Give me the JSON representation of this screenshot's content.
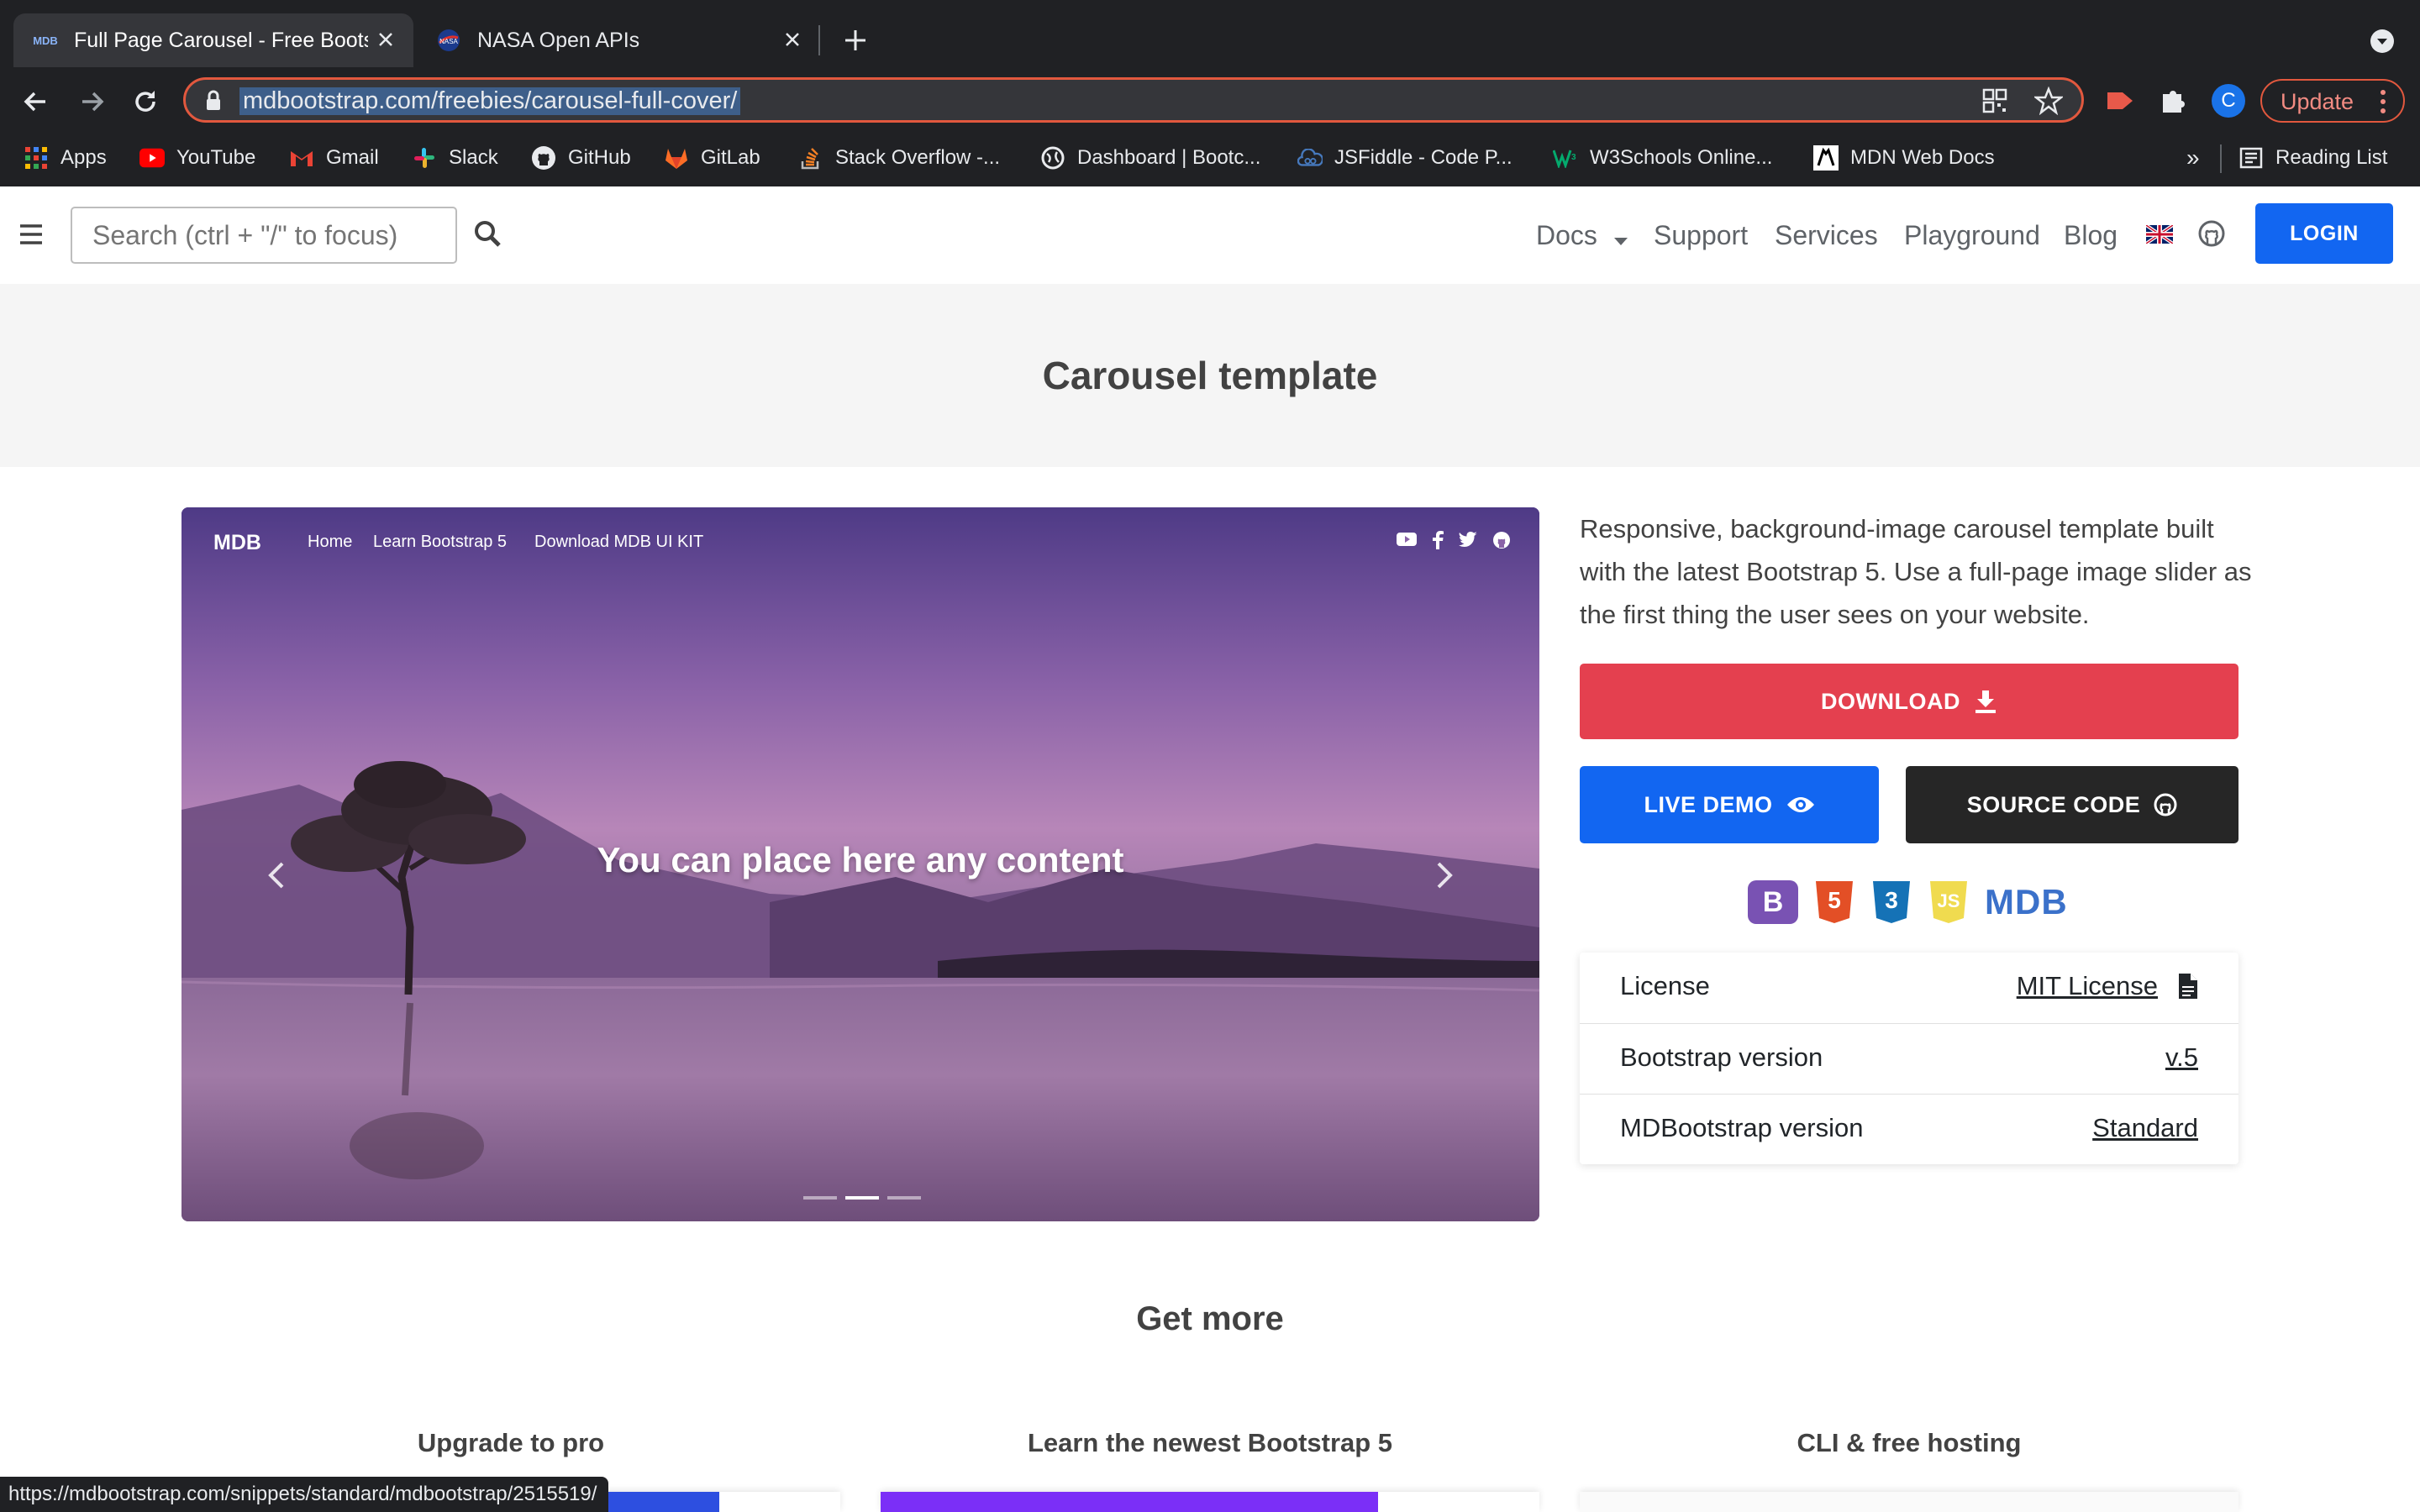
{
  "browser": {
    "tabs": [
      {
        "title": "Full Page Carousel - Free Bootst",
        "active": true
      },
      {
        "title": "NASA Open APIs",
        "active": false
      }
    ],
    "url": "mdbootstrap.com/freebies/carousel-full-cover/",
    "profile_initial": "C",
    "update_label": "Update",
    "bookmarks": [
      {
        "label": "Apps",
        "icon": "apps-grid-icon"
      },
      {
        "label": "YouTube",
        "icon": "youtube-icon"
      },
      {
        "label": "Gmail",
        "icon": "gmail-icon"
      },
      {
        "label": "Slack",
        "icon": "slack-icon"
      },
      {
        "label": "GitHub",
        "icon": "github-icon"
      },
      {
        "label": "GitLab",
        "icon": "gitlab-icon"
      },
      {
        "label": "Stack Overflow -...",
        "icon": "stackoverflow-icon"
      },
      {
        "label": "Dashboard | Bootc...",
        "icon": "globe-icon"
      },
      {
        "label": "JSFiddle - Code P...",
        "icon": "jsfiddle-icon"
      },
      {
        "label": "W3Schools Online...",
        "icon": "w3schools-icon"
      },
      {
        "label": "MDN Web Docs",
        "icon": "mdn-icon"
      }
    ],
    "overflow_label": "»",
    "reading_list_label": "Reading List",
    "status_url": "https://mdbootstrap.com/snippets/standard/mdbootstrap/2515519/"
  },
  "site_nav": {
    "search_placeholder": "Search (ctrl + \"/\" to focus)",
    "links": [
      "Docs",
      "Support",
      "Services",
      "Playground",
      "Blog"
    ],
    "login_label": "LOGIN"
  },
  "hero": {
    "title": "Carousel template"
  },
  "preview": {
    "brand": "MDB",
    "nav": [
      "Home",
      "Learn Bootstrap 5",
      "Download MDB UI KIT"
    ],
    "caption": "You can place here any content",
    "active_slide": 2,
    "slide_count": 3
  },
  "side": {
    "description": "Responsive, background-image carousel template built with the latest Bootstrap 5. Use a full-page image slider as the first thing the user sees on your website.",
    "download_label": "DOWNLOAD",
    "live_demo_label": "LIVE DEMO",
    "source_code_label": "SOURCE CODE",
    "tech_badges": [
      "B",
      "5",
      "3",
      "JS",
      "MDB"
    ],
    "info": [
      {
        "label": "License",
        "value": "MIT License"
      },
      {
        "label": "Bootstrap version",
        "value": "v.5"
      },
      {
        "label": "MDBootstrap version",
        "value": "Standard"
      }
    ]
  },
  "get_more": {
    "title": "Get more",
    "cards": [
      "Upgrade to pro",
      "Learn the newest Bootstrap 5",
      "CLI & free hosting"
    ]
  },
  "colors": {
    "accent_red": "#e4404f",
    "accent_blue": "#1266f1",
    "dark": "#262626"
  }
}
